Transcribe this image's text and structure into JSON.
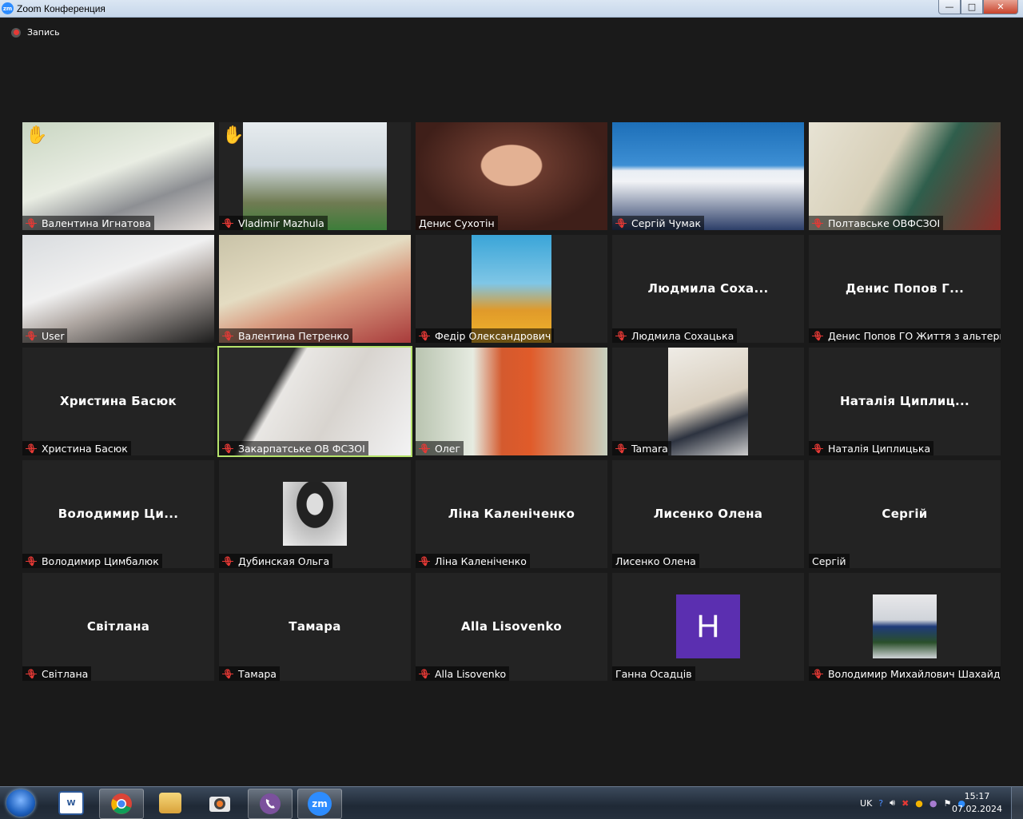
{
  "window": {
    "title": "Zoom Конференция",
    "minimize": "—",
    "maximize": "□",
    "close": "✕"
  },
  "recording": {
    "label": "Запись"
  },
  "tiles": [
    {
      "name": "Валентина Игнатова",
      "video": true,
      "hand": true
    },
    {
      "name": "Vladimir Mazhula",
      "video": true,
      "hand": true
    },
    {
      "name": "Денис Сухотін",
      "video": true,
      "muted": false
    },
    {
      "name": "Сергій Чумак",
      "video": true
    },
    {
      "name": "Полтавське ОВФСЗОІ",
      "video": true
    },
    {
      "name": "User",
      "video": true
    },
    {
      "name": "Валентина Петренко",
      "video": true
    },
    {
      "name": "Федір Олександрович",
      "video": true
    },
    {
      "name": "Людмила Сохацька",
      "center": "Людмила  Соха..."
    },
    {
      "name": "Денис Попов ГО Життя з альтерн...",
      "center": "Денис Попов Г..."
    },
    {
      "name": "Христина Басюк",
      "center": "Христина Басюк"
    },
    {
      "name": "Закарпатське ОВ ФСЗОІ",
      "video": true,
      "active": true
    },
    {
      "name": "Олег",
      "video": true
    },
    {
      "name": "Tamara",
      "video": true
    },
    {
      "name": "Наталія Циплицька",
      "center": "Наталія  Циплиц..."
    },
    {
      "name": "Володимир Цимбалюк",
      "center": "Володимир  Ци..."
    },
    {
      "name": "Дубинская Ольга",
      "photo": true
    },
    {
      "name": "Ліна Каленіченко",
      "center": "Ліна Каленіченко"
    },
    {
      "name": "Лисенко Олена",
      "center": "Лисенко Олена",
      "muted": false
    },
    {
      "name": "Сергій",
      "center": "Сергій",
      "muted": false
    },
    {
      "name": "Світлана",
      "center": "Світлана"
    },
    {
      "name": "Тамара",
      "center": "Тамара"
    },
    {
      "name": "Alla Lisovenko",
      "center": "Alla Lisovenko"
    },
    {
      "name": "Ганна Осадців",
      "initial": "H",
      "muted": false
    },
    {
      "name": "Володимир Михайлович Шахайда",
      "photo": true
    }
  ],
  "taskbar": {
    "apps": [
      "word-icon",
      "chrome-icon",
      "explorer-icon",
      "camera-icon",
      "viber-icon",
      "zoom-icon"
    ],
    "lang": "UK",
    "time": "15:17",
    "date": "07.02.2024"
  }
}
